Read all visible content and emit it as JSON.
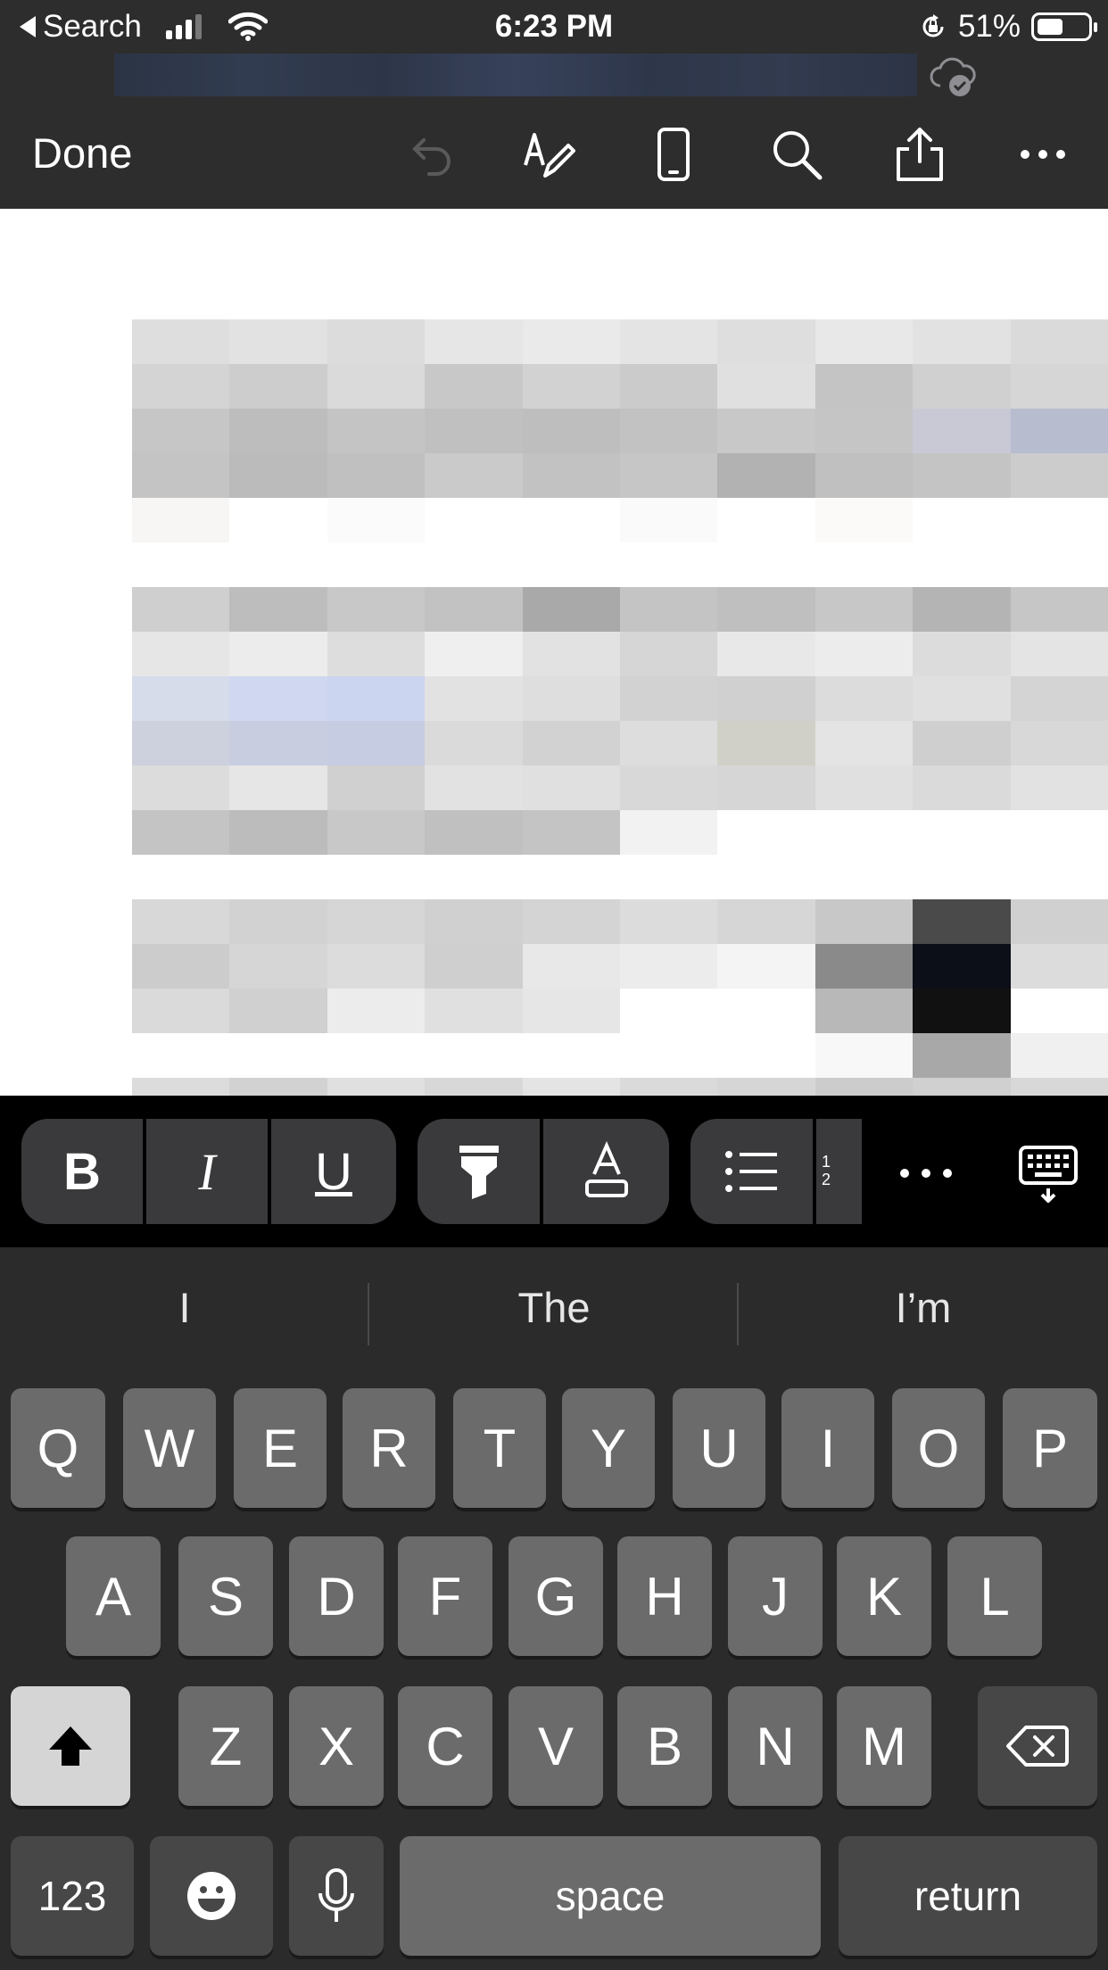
{
  "status_bar": {
    "back_label": "Search",
    "time": "6:23 PM",
    "battery_percent": "51%",
    "battery_level": 0.51,
    "signal_bars_active": 3,
    "signal_bars_total": 4
  },
  "toolbar": {
    "done_label": "Done",
    "icons": [
      "undo-icon",
      "draw-pen-icon",
      "mobile-view-icon",
      "search-icon",
      "share-icon",
      "more-icon"
    ]
  },
  "format_bar": {
    "bold_label": "B",
    "italic_label": "I",
    "underline_label": "U",
    "font_color_label": "A",
    "icons": [
      "highlighter-icon",
      "font-color-icon",
      "bullet-list-icon",
      "numbered-list-icon",
      "more-icon",
      "keyboard-dismiss-icon"
    ]
  },
  "keyboard": {
    "suggestions": [
      "I",
      "The",
      "I’m"
    ],
    "row1": [
      "Q",
      "W",
      "E",
      "R",
      "T",
      "Y",
      "U",
      "I",
      "O",
      "P"
    ],
    "row2": [
      "A",
      "S",
      "D",
      "F",
      "G",
      "H",
      "J",
      "K",
      "L"
    ],
    "row3": [
      "Z",
      "X",
      "C",
      "V",
      "B",
      "N",
      "M"
    ],
    "numbers_label": "123",
    "space_label": "space",
    "return_label": "return"
  },
  "colors": {
    "bar_background": "#2d2d2d",
    "keyboard_background": "#2b2b2b",
    "key_background": "#6b6b6b",
    "format_bar_background": "#000000",
    "document_background": "#ffffff"
  }
}
